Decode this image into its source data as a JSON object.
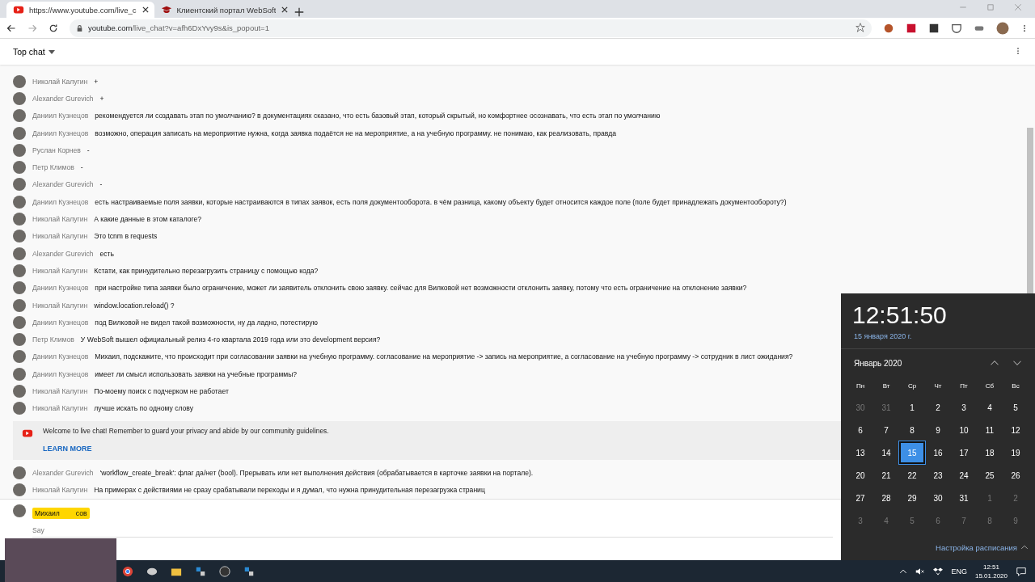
{
  "browser": {
    "tabs": [
      {
        "title": "https://www.youtube.com/live_c",
        "selected": true,
        "kind": "video"
      },
      {
        "title": "Клиентский портал WebSoft",
        "selected": false,
        "kind": "portal"
      }
    ],
    "url_host": "youtube.com",
    "url_path": "/live_chat?v=afh6DxYvy9s&is_popout=1"
  },
  "chat": {
    "header": "Top chat",
    "messages": [
      {
        "author": "Николай Калугин",
        "text": "+"
      },
      {
        "author": "Alexander Gurevich",
        "text": "+"
      },
      {
        "author": "Даниил Кузнецов",
        "text": "рекомендуется ли создавать этап по умолчанию? в документациях сказано, что есть базовый этап, который скрытый, но комфортнее осознавать, что есть этап по умолчанию"
      },
      {
        "author": "Даниил Кузнецов",
        "text": "возможно, операция записать на мероприятие нужна, когда заявка подаётся не на мероприятие, а на учебную программу. не понимаю, как реализовать, правда"
      },
      {
        "author": "Руслан Корнев",
        "text": "-"
      },
      {
        "author": "Петр Климов",
        "text": "-"
      },
      {
        "author": "Alexander Gurevich",
        "text": "-"
      },
      {
        "author": "Даниил Кузнецов",
        "text": "есть настраиваемые поля заявки, которые настраиваются в типах заявок, есть поля документооборота. в чём разница, какому объекту будет относится каждое поле (поле будет принадлежать документообороту?)"
      },
      {
        "author": "Николай Калугин",
        "text": "А какие данные в этом каталоге?"
      },
      {
        "author": "Николай Калугин",
        "text": "Это tcnm в requests"
      },
      {
        "author": "Alexander Gurevich",
        "text": "есть"
      },
      {
        "author": "Николай Калугин",
        "text": "Кстати, как принудительно перезагрузить страницу с помощью кода?"
      },
      {
        "author": "Даниил Кузнецов",
        "text": "при настройке типа заявки было ограничение, может ли заявитель отклонить свою заявку. сейчас для Вилковой нет возможности отклонить заявку, потому что есть ограничение на отклонение заявки?"
      },
      {
        "author": "Николай Калугин",
        "text": "window.location.reload() ?"
      },
      {
        "author": "Даниил Кузнецов",
        "text": "под Вилковой не видел такой возможности, ну да ладно, потестирую"
      },
      {
        "author": "Петр Климов",
        "text": "У WebSoft вышел официальный релиз 4-го квартала 2019 года или это development версия?"
      },
      {
        "author": "Даниил Кузнецов",
        "text": "Михаил, подскажите, что происходит при согласовании заявки на учебную программу. согласование на мероприятие -> запись на мероприятие, а согласование на учебную программу -> сотрудник в лист ожидания?"
      },
      {
        "author": "Даниил Кузнецов",
        "text": "имеет ли смысл использовать заявки на учебные программы?"
      },
      {
        "author": "Николай Калугин",
        "text": "По-моему поиск с подчерком не работает"
      },
      {
        "author": "Николай Калугин",
        "text": "лучше искать по одному слову"
      }
    ],
    "banner": {
      "text": "Welcome to live chat! Remember to guard your privacy and abide by our community guidelines.",
      "link": "LEARN MORE"
    },
    "later_messages": [
      {
        "author": "Alexander Gurevich",
        "text": "'workflow_create_break': флаг да/нет (bool). Прерывать или нет выполнения действия (обрабатывается в карточке заявки на портале)."
      },
      {
        "author": "Николай Калугин",
        "text": "На примерах с действиями не сразу срабатывали переходы и я думал, что нужна принудительная перезагрузка страниц"
      }
    ],
    "input": {
      "author": "Михаил",
      "author_end": "сов",
      "placeholder": "Say"
    }
  },
  "clock": {
    "time": "12:51:50",
    "date": "15 января 2020 г.",
    "month": "Январь 2020",
    "weekdays": [
      "Пн",
      "Вт",
      "Ср",
      "Чт",
      "Пт",
      "Сб",
      "Вс"
    ],
    "weeks": [
      [
        {
          "d": "30",
          "other": true,
          "selected": false
        },
        {
          "d": "31",
          "other": true,
          "selected": false
        },
        {
          "d": "1",
          "other": false,
          "selected": false
        },
        {
          "d": "2",
          "other": false,
          "selected": false
        },
        {
          "d": "3",
          "other": false,
          "selected": false
        },
        {
          "d": "4",
          "other": false,
          "selected": false
        },
        {
          "d": "5",
          "other": false,
          "selected": false
        }
      ],
      [
        {
          "d": "6",
          "other": false,
          "selected": false
        },
        {
          "d": "7",
          "other": false,
          "selected": false
        },
        {
          "d": "8",
          "other": false,
          "selected": false
        },
        {
          "d": "9",
          "other": false,
          "selected": false
        },
        {
          "d": "10",
          "other": false,
          "selected": false
        },
        {
          "d": "11",
          "other": false,
          "selected": false
        },
        {
          "d": "12",
          "other": false,
          "selected": false
        }
      ],
      [
        {
          "d": "13",
          "other": false,
          "selected": false
        },
        {
          "d": "14",
          "other": false,
          "selected": false
        },
        {
          "d": "15",
          "other": false,
          "selected": true
        },
        {
          "d": "16",
          "other": false,
          "selected": false
        },
        {
          "d": "17",
          "other": false,
          "selected": false
        },
        {
          "d": "18",
          "other": false,
          "selected": false
        },
        {
          "d": "19",
          "other": false,
          "selected": false
        }
      ],
      [
        {
          "d": "20",
          "other": false,
          "selected": false
        },
        {
          "d": "21",
          "other": false,
          "selected": false
        },
        {
          "d": "22",
          "other": false,
          "selected": false
        },
        {
          "d": "23",
          "other": false,
          "selected": false
        },
        {
          "d": "24",
          "other": false,
          "selected": false
        },
        {
          "d": "25",
          "other": false,
          "selected": false
        },
        {
          "d": "26",
          "other": false,
          "selected": false
        }
      ],
      [
        {
          "d": "27",
          "other": false,
          "selected": false
        },
        {
          "d": "28",
          "other": false,
          "selected": false
        },
        {
          "d": "29",
          "other": false,
          "selected": false
        },
        {
          "d": "30",
          "other": false,
          "selected": false
        },
        {
          "d": "31",
          "other": false,
          "selected": false
        },
        {
          "d": "1",
          "other": true,
          "selected": false
        },
        {
          "d": "2",
          "other": true,
          "selected": false
        }
      ],
      [
        {
          "d": "3",
          "other": true,
          "selected": false
        },
        {
          "d": "4",
          "other": true,
          "selected": false
        },
        {
          "d": "5",
          "other": true,
          "selected": false
        },
        {
          "d": "6",
          "other": true,
          "selected": false
        },
        {
          "d": "7",
          "other": true,
          "selected": false
        },
        {
          "d": "8",
          "other": true,
          "selected": false
        },
        {
          "d": "9",
          "other": true,
          "selected": false
        }
      ]
    ],
    "agenda_link": "Настройка расписания"
  },
  "taskbar": {
    "language": "ENG",
    "time": "12:51",
    "date": "15.01.2020"
  }
}
